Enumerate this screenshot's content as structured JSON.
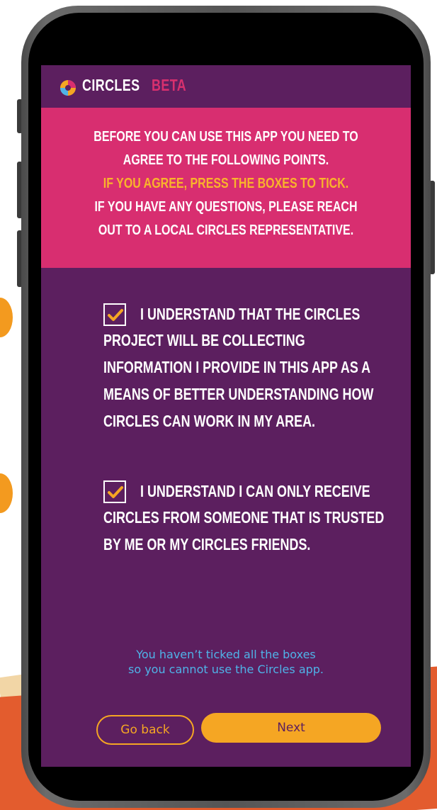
{
  "header": {
    "app_name": "CIRCLES",
    "tag": "BETA",
    "logo_icon": "circles-logo-icon"
  },
  "intro": {
    "line1": "BEFORE YOU CAN USE THIS APP YOU NEED TO",
    "line2": "AGREE TO THE FOLLOWING POINTS.",
    "line3": "IF YOU AGREE, PRESS THE BOXES TO TICK.",
    "line4": "IF YOU HAVE ANY QUESTIONS, PLEASE REACH",
    "line5": "OUT TO A LOCAL CIRCLES REPRESENTATIVE."
  },
  "consents": [
    {
      "checked": true,
      "lines": [
        "I UNDERSTAND THAT THE CIRCLES",
        "PROJECT WILL BE COLLECTING",
        "INFORMATION I PROVIDE IN THIS APP AS A",
        "MEANS OF BETTER UNDERSTANDING HOW",
        "CIRCLES CAN WORK IN MY AREA."
      ]
    },
    {
      "checked": true,
      "lines": [
        "I UNDERSTAND I CAN ONLY RECEIVE",
        "CIRCLES FROM SOMEONE THAT IS TRUSTED",
        "BY ME OR MY CIRCLES FRIENDS."
      ]
    }
  ],
  "warning": {
    "line1": "You haven’t ticked all the boxes",
    "line2": "so you cannot use the Circles app."
  },
  "buttons": {
    "back_label": "Go back",
    "next_label": "Next"
  },
  "colors": {
    "background_purple": "#5c1f5f",
    "banner_pink": "#d82e70",
    "accent_orange": "#f5a623",
    "warning_blue": "#4fb3e8"
  }
}
